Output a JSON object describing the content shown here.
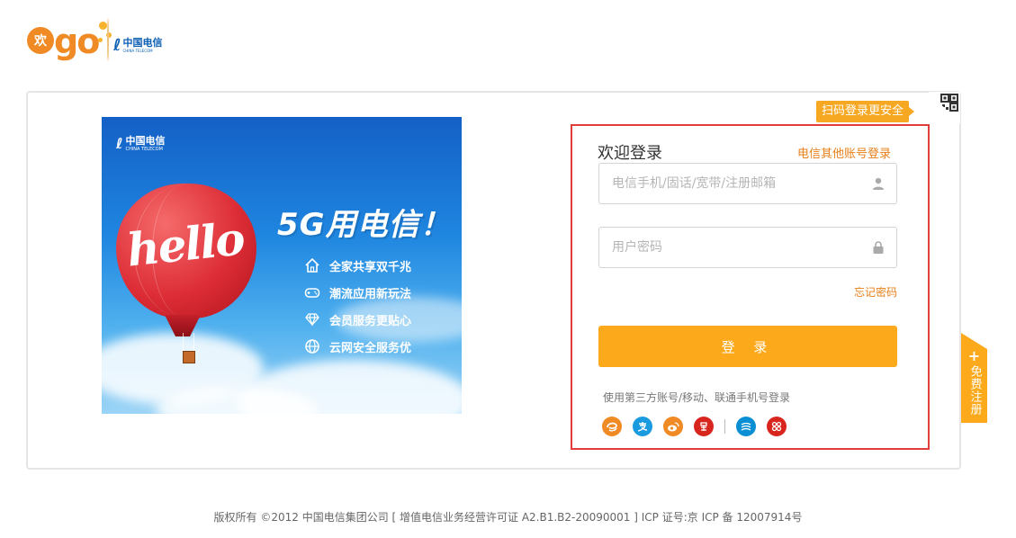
{
  "brand": {
    "logo_char": "欢",
    "logo_text": "go",
    "partner_cn": "中国电信",
    "partner_en": "CHINA TELECOM"
  },
  "banner": {
    "logo_cn": "中国电信",
    "logo_en": "CHINA TELECOM",
    "balloon_text": "hello",
    "title": "5G用电信！",
    "features": [
      {
        "icon": "home-icon",
        "label": "全家共享双千兆"
      },
      {
        "icon": "gamepad-icon",
        "label": "潮流应用新玩法"
      },
      {
        "icon": "diamond-icon",
        "label": "会员服务更贴心"
      },
      {
        "icon": "globe-icon",
        "label": "云网安全服务优"
      }
    ]
  },
  "qr": {
    "tip": "扫码登录更安全"
  },
  "login": {
    "title": "欢迎登录",
    "other_account_link": "电信其他账号登录",
    "account_placeholder": "电信手机/固话/宽带/注册邮箱",
    "password_placeholder": "用户密码",
    "forgot_link": "忘记密码",
    "submit_label": "登 录",
    "third_party_tip": "使用第三方账号/移动、联通手机号登录",
    "socials": [
      {
        "name": "tianyi-icon",
        "color": "#f08a24",
        "glyph": "e"
      },
      {
        "name": "alipay-icon",
        "color": "#1a9be0",
        "glyph": "支"
      },
      {
        "name": "weibo-icon",
        "color": "#f08a24",
        "glyph": "微"
      },
      {
        "name": "douban-icon",
        "color": "#d8261e",
        "glyph": "易"
      },
      {
        "name": "china-mobile-icon",
        "color": "#0b8fd4",
        "glyph": "移"
      },
      {
        "name": "china-unicom-icon",
        "color": "#d8261e",
        "glyph": "联"
      }
    ]
  },
  "register": {
    "label": "免费注册"
  },
  "footer": {
    "copyright": "版权所有 ©2012 中国电信集团公司 [ 增值电信业务经营许可证 A2.B1.B2-20090001 ] ICP 证号:京 ICP 备 12007914号"
  },
  "colors": {
    "accent": "#fcaa1b",
    "link": "#e7801a",
    "highlight_border": "#e23c3c"
  }
}
